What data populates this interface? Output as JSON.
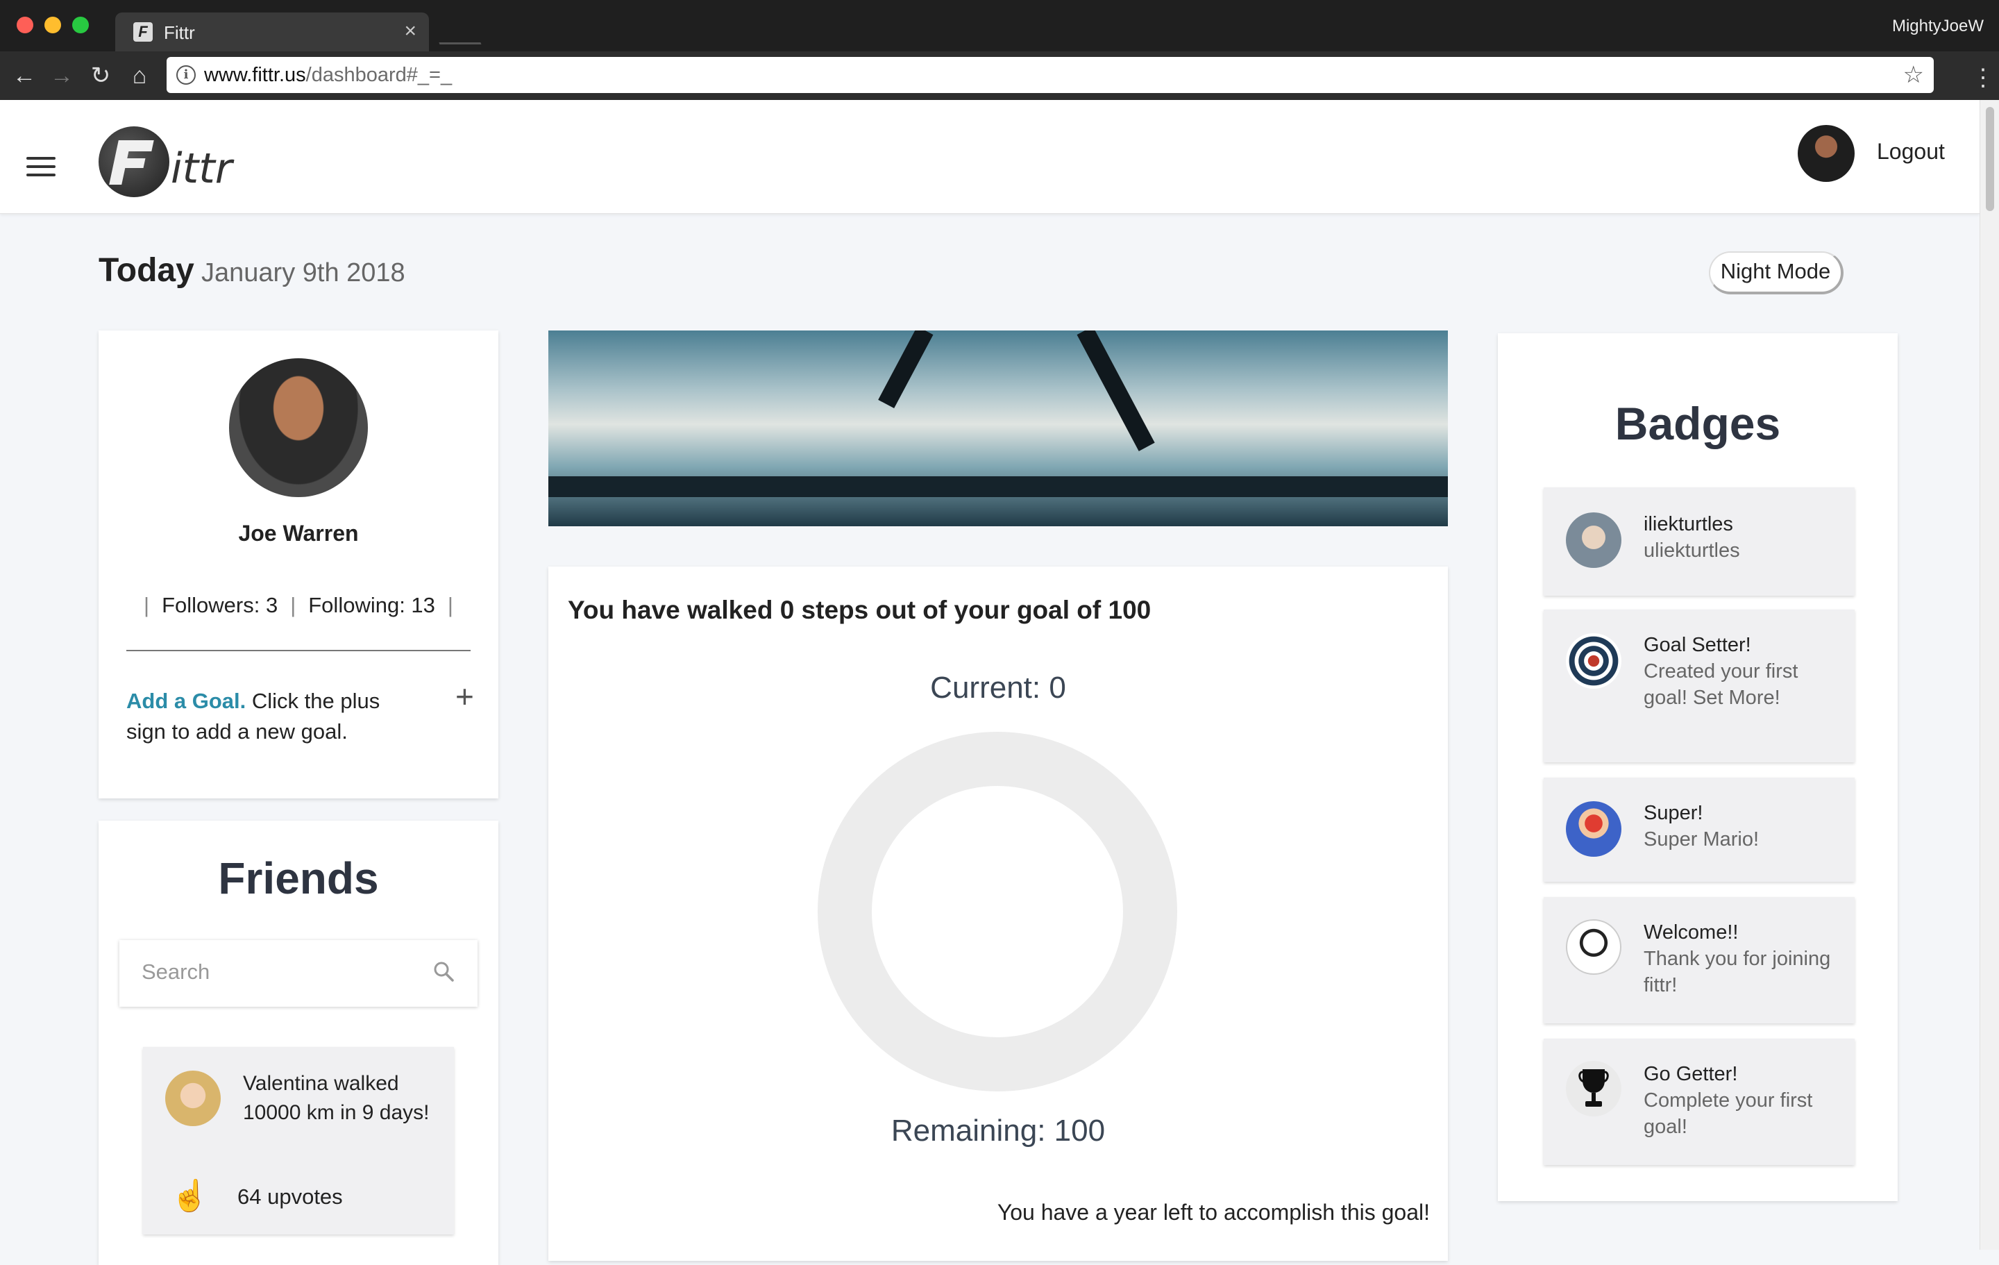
{
  "browser": {
    "tab_title": "Fittr",
    "profile_name": "MightyJoeW",
    "url_host": "www.fittr.us",
    "url_path": "/dashboard#_=_",
    "tab_favicon_letter": "F"
  },
  "app": {
    "logo_text": "ittr",
    "logout_label": "Logout",
    "night_mode_label": "Night Mode"
  },
  "heading": {
    "today": "Today",
    "date": "January 9th 2018"
  },
  "profile": {
    "name": "Joe Warren",
    "followers": "Followers: 3",
    "following": "Following: 13",
    "add_goal_link": "Add a Goal.",
    "add_goal_text": " Click the plus sign to add a new goal.",
    "plus_symbol": "+"
  },
  "friends": {
    "title": "Friends",
    "search_placeholder": "Search",
    "items": [
      {
        "text": "Valentina walked 10000 km in 9 days!",
        "upvotes": "64 upvotes"
      }
    ]
  },
  "progress": {
    "goal_line": "You have walked 0 steps out of your goal of 100",
    "current": "Current: 0",
    "remaining": "Remaining: 100",
    "time_left": "You have a year left to accomplish this goal!",
    "steps_walked": 0,
    "steps_goal": 100
  },
  "badges": {
    "title": "Badges",
    "items": [
      {
        "name": "iliekturtles",
        "desc": "uliekturtles"
      },
      {
        "name": "Goal Setter!",
        "desc": "Created your first goal! Set More!"
      },
      {
        "name": "Super!",
        "desc": "Super Mario!"
      },
      {
        "name": "Welcome!!",
        "desc": "Thank you for joining fittr!"
      },
      {
        "name": "Go Getter!",
        "desc": "Complete your first goal!"
      }
    ]
  },
  "colors": {
    "accent_link": "#2b8ca8",
    "heading_dark": "#2e3441",
    "ring_gray": "#ececec"
  }
}
